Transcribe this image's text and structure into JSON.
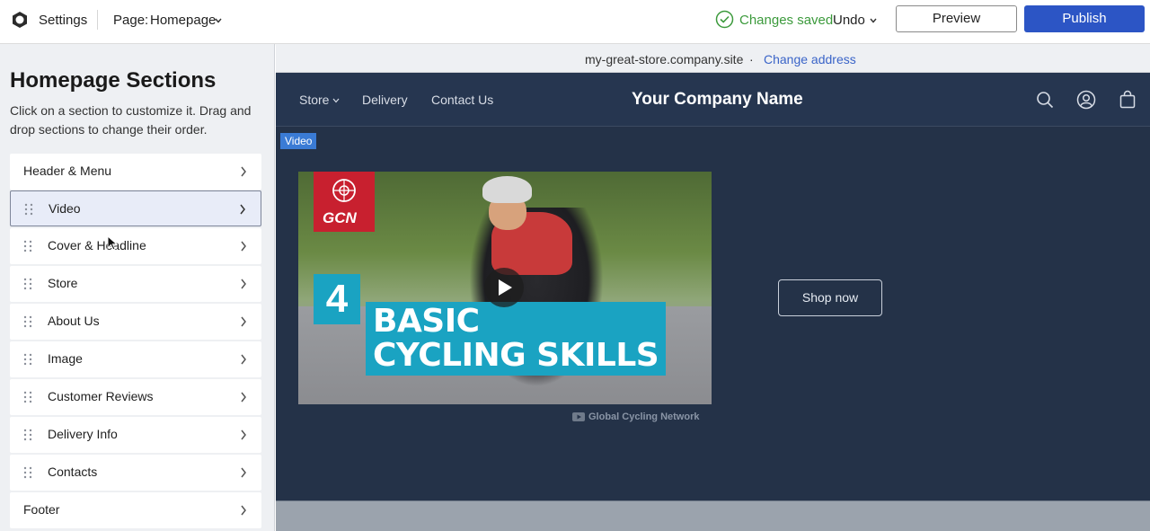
{
  "topbar": {
    "settings_label": "Settings",
    "page_label": "Page:",
    "page_value": "Homepage",
    "saved_text": "Changes saved",
    "undo_label": "Undo",
    "preview_label": "Preview",
    "publish_label": "Publish"
  },
  "sidebar": {
    "title": "Homepage Sections",
    "description": "Click on a section to customize it. Drag and drop sections to change their order.",
    "items": [
      {
        "label": "Header & Menu"
      },
      {
        "label": "Video"
      },
      {
        "label": "Cover & Headline"
      },
      {
        "label": "Store"
      },
      {
        "label": "About Us"
      },
      {
        "label": "Image"
      },
      {
        "label": "Customer Reviews"
      },
      {
        "label": "Delivery Info"
      },
      {
        "label": "Contacts"
      },
      {
        "label": "Footer"
      }
    ]
  },
  "address": {
    "domain": "my-great-store.company.site",
    "dot": "·",
    "change_label": "Change address"
  },
  "site": {
    "nav": {
      "store": "Store",
      "delivery": "Delivery",
      "contact": "Contact Us"
    },
    "company_name": "Your Company Name",
    "video_tag": "Video",
    "video": {
      "logo_text": "GCN",
      "number": "4",
      "title_line1": "BASIC",
      "title_line2": "CYCLING SKILLS",
      "channel": "Global Cycling Network"
    },
    "shop_label": "Shop now"
  },
  "colors": {
    "publish": "#2c55c5",
    "saved": "#3c9a3c",
    "link": "#3a64c8",
    "site_bg": "#243248",
    "accent_teal": "#1aa3c2",
    "gcn_red": "#c8202f"
  }
}
